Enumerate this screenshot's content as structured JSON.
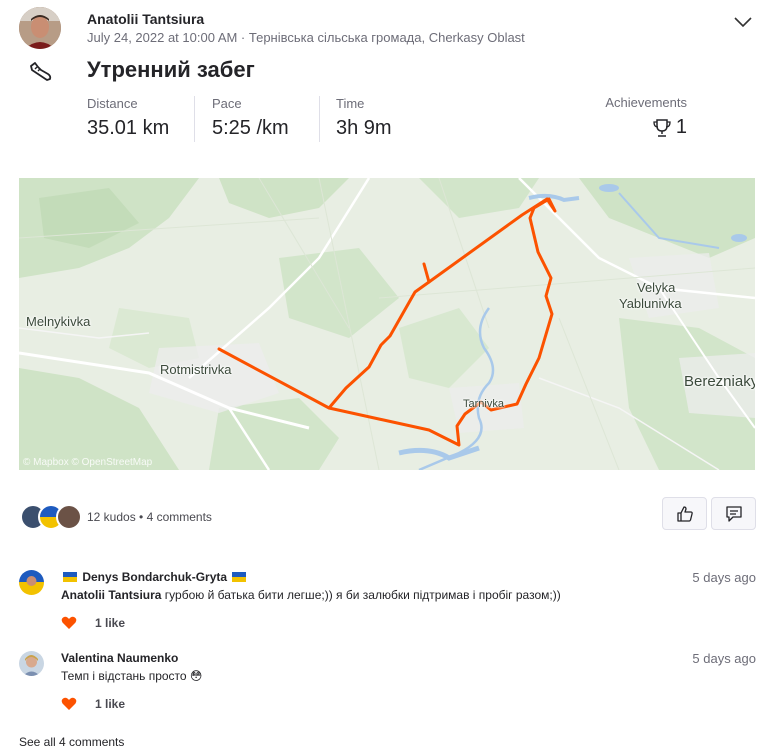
{
  "activity": {
    "athlete_name": "Anatolii Tantsiura",
    "meta": "July 24, 2022 at 10:00 AM · Тернівська сільська громада, Cherkasy Oblast",
    "title": "Утренний забег",
    "sport_icon": "running-shoe-icon"
  },
  "stats": [
    {
      "label": "Distance",
      "value": "35.01 km"
    },
    {
      "label": "Pace",
      "value": "5:25 /km"
    },
    {
      "label": "Time",
      "value": "3h 9m"
    }
  ],
  "achievements": {
    "label": "Achievements",
    "value": "1",
    "icon": "trophy-icon"
  },
  "map": {
    "labels": [
      "Melnykivka",
      "Rotmistrivka",
      "Velyka",
      "Yablunivka",
      "Berezniaky",
      "Tarnivka"
    ],
    "attribution": "© Mapbox © OpenStreetMap",
    "route_color": "#fc5200"
  },
  "social": {
    "kudos_text": "12 kudos • 4 comments",
    "kudos_icon": "thumbs-up-icon",
    "comment_icon": "comment-icon"
  },
  "comments": [
    {
      "name": "Denys Bondarchuk-Gryta",
      "time": "5 days ago",
      "mention": "Anatolii Tantsiura",
      "text": " гурбою й батька бити легше;)) я би залюбки підтримав і пробіг разом;))",
      "likes": "1 like"
    },
    {
      "name": "Valentina Naumenko",
      "time": "5 days ago",
      "text": "Темп і відстань просто 😳",
      "likes": "1 like"
    }
  ],
  "see_all": "See all 4 comments",
  "colors": {
    "accent": "#fc5200",
    "heart": "#fc5200",
    "muted_text": "#6d6d78"
  }
}
